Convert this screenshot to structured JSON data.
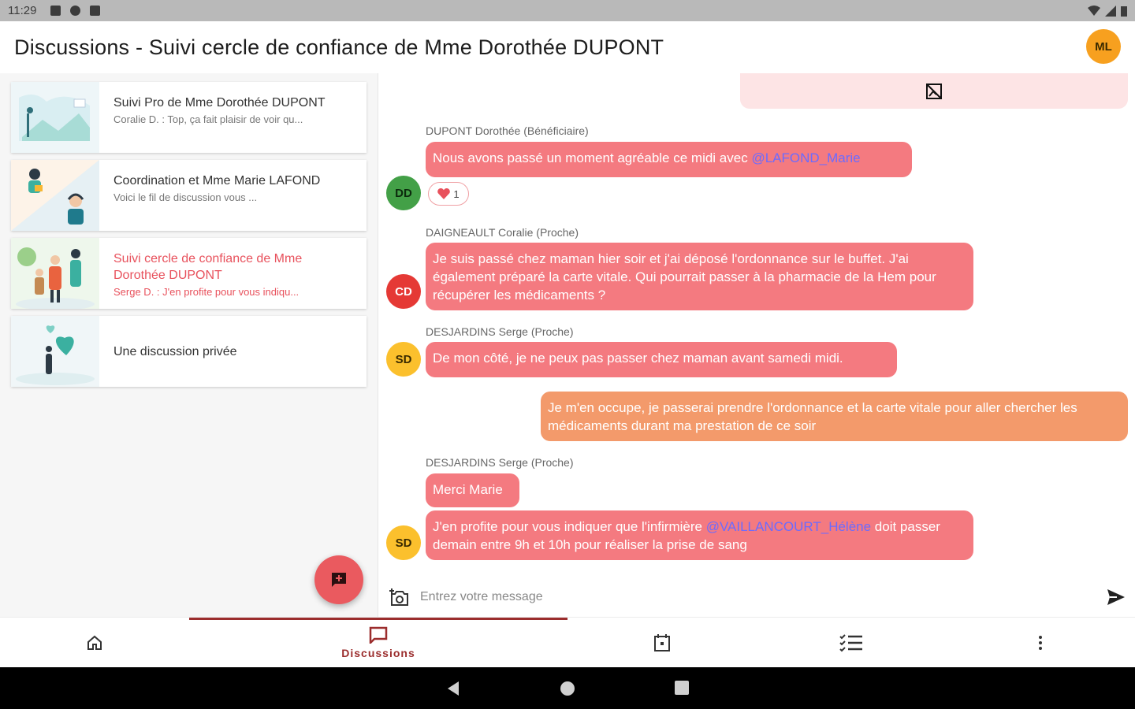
{
  "status_bar": {
    "time": "11:29"
  },
  "header": {
    "title": "Discussions - Suivi cercle de confiance de Mme Dorothée DUPONT",
    "user_initials": "ML"
  },
  "conversations": [
    {
      "name": "Suivi Pro de Mme Dorothée DUPONT",
      "preview": "Coralie D. : Top, ça fait plaisir de voir qu...",
      "active": false
    },
    {
      "name": "Coordination et Mme Marie LAFOND",
      "preview": "Voici le fil de discussion vous ...",
      "active": false
    },
    {
      "name": "Suivi cercle de confiance de Mme Dorothée DUPONT",
      "preview": "Serge D. : J'en profite pour vous indiqu...",
      "active": true
    },
    {
      "name": "Une discussion privée",
      "preview": "",
      "active": false
    }
  ],
  "messages": {
    "m1": {
      "author": "DUPONT Dorothée (Bénéficiaire)",
      "initials": "DD",
      "text": "Nous avons passé un moment agréable ce midi avec ",
      "mention": "@LAFOND_Marie",
      "reaction_count": "1"
    },
    "m2": {
      "author": "DAIGNEAULT Coralie (Proche)",
      "initials": "CD",
      "text": "Je suis passé chez maman hier soir et j'ai déposé l'ordonnance sur le buffet. J'ai également préparé la carte vitale. Qui pourrait passer à la pharmacie de la Hem pour récupérer les médicaments ?"
    },
    "m3": {
      "author": "DESJARDINS Serge (Proche)",
      "initials": "SD",
      "text": "De mon côté, je ne peux pas passer chez maman avant samedi midi."
    },
    "m4": {
      "text": "Je m'en occupe, je passerai prendre l'ordonnance et la carte vitale pour aller chercher les médicaments durant ma prestation de ce soir"
    },
    "m5": {
      "author": "DESJARDINS Serge (Proche)",
      "initials": "SD",
      "text_a": "Merci Marie",
      "text_b_1": "J'en profite pour vous indiquer que l'infirmière ",
      "mention": "@VAILLANCOURT_Hélène",
      "text_b_2": " doit passer demain entre 9h et 10h pour réaliser la prise de sang"
    }
  },
  "composer": {
    "placeholder": "Entrez votre message"
  },
  "bottom_nav": {
    "discussions_label": "Discussions"
  },
  "colors": {
    "accent": "#ea5a5f",
    "bubble_other": "#f47a80",
    "bubble_self": "#f39a6b",
    "avatar_dd": "#43a047",
    "avatar_cd": "#e53935",
    "avatar_sd": "#fbc02d",
    "avatar_ml": "#f7a01f"
  }
}
